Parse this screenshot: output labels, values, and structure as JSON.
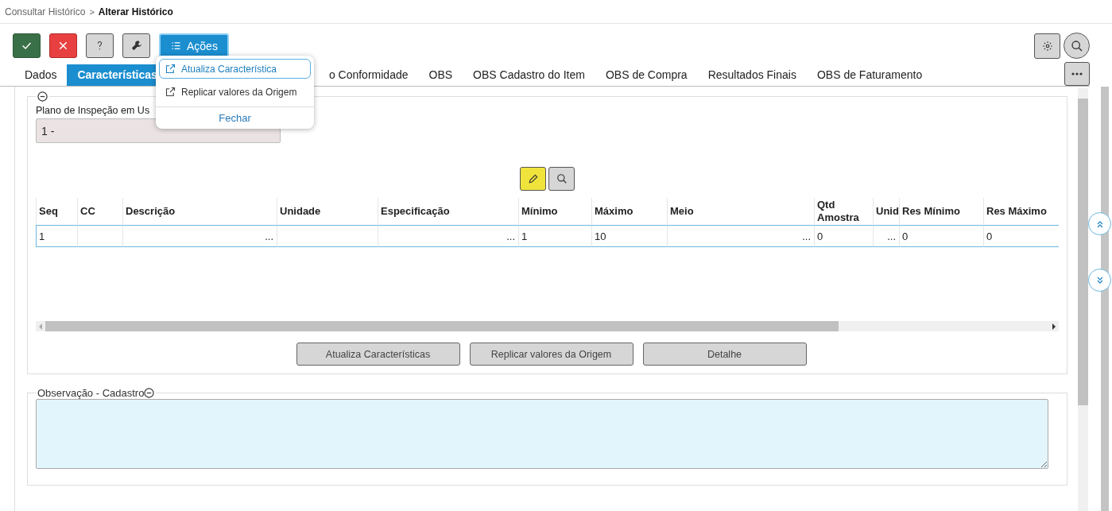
{
  "breadcrumb": [
    {
      "text": "Consultar Histórico",
      "current": false
    },
    {
      "text": "Alterar Histórico",
      "current": true
    }
  ],
  "breadcrumb_separator": ">",
  "toolbar": [
    {
      "kind": "confirm"
    },
    {
      "kind": "cancel"
    },
    {
      "kind": "help"
    },
    {
      "kind": "tools"
    },
    {
      "kind": "actions",
      "label": "Ações"
    }
  ],
  "tabs": [
    {
      "label": "Dados",
      "selected": false
    },
    {
      "label": "Características",
      "selected": true
    },
    {
      "label": "o Conformidade",
      "selected": false
    },
    {
      "label": "OBS",
      "selected": false
    },
    {
      "label": "OBS Cadastro do Item",
      "selected": false
    },
    {
      "label": "OBS de Compra",
      "selected": false
    },
    {
      "label": "Resultados Finais",
      "selected": false
    },
    {
      "label": "OBS de Faturamento",
      "selected": false
    }
  ],
  "actions_menu": {
    "items": [
      {
        "label": "Atualiza Característica",
        "selected": true
      },
      {
        "label": "Replicar valores da Origem",
        "selected": false
      }
    ],
    "close": "Fechar"
  },
  "characteristics": {
    "plan_label": "Plano de Inspeção em Us",
    "plan_value": "1 -",
    "grid": {
      "columns": [
        "Seq",
        "CC",
        "Descrição",
        "Unidade",
        "Especificação",
        "Mínimo",
        "Máximo",
        "Meio",
        "Qtd Amostra",
        "Unid",
        "Res Mínimo",
        "Res Máximo"
      ],
      "rows": [
        {
          "selected": true,
          "cells": [
            {
              "kind": "text",
              "value": "1"
            },
            {
              "kind": "text"
            },
            {
              "kind": "lookup",
              "value": "..."
            },
            {
              "kind": "text"
            },
            {
              "kind": "lookup",
              "value": "..."
            },
            {
              "kind": "text",
              "value": "1"
            },
            {
              "kind": "text",
              "value": "10"
            },
            {
              "kind": "lookup",
              "value": "..."
            },
            {
              "kind": "text",
              "value": "0"
            },
            {
              "kind": "lookup",
              "value": "..."
            },
            {
              "kind": "text",
              "value": "0"
            },
            {
              "kind": "text",
              "value": "0"
            }
          ]
        }
      ]
    },
    "buttons": [
      "Atualiza Características",
      "Replicar valores da Origem",
      "Detalhe"
    ]
  },
  "observation": {
    "legend": "Observação - Cadastro"
  }
}
